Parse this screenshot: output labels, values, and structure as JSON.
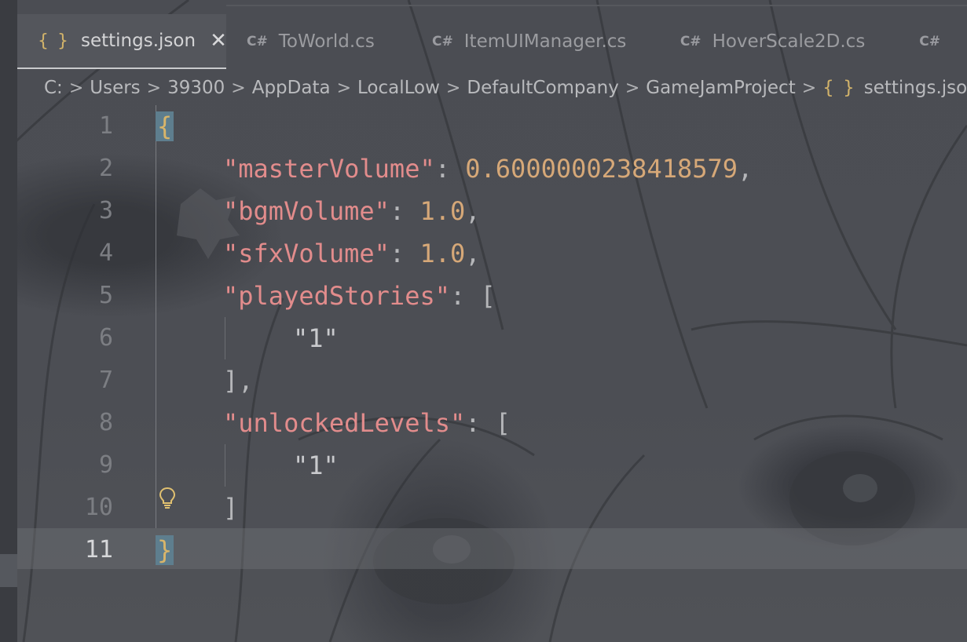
{
  "tabs": [
    {
      "icon": "{ }",
      "label": "settings.json",
      "active": true,
      "close": "✕"
    },
    {
      "icon": "C#",
      "label": "ToWorld.cs",
      "active": false
    },
    {
      "icon": "C#",
      "label": "ItemUIManager.cs",
      "active": false
    },
    {
      "icon": "C#",
      "label": "HoverScale2D.cs",
      "active": false
    },
    {
      "icon": "C#",
      "label": "",
      "active": false
    }
  ],
  "breadcrumb": {
    "items": [
      "C:",
      "Users",
      "39300",
      "AppData",
      "LocalLow",
      "DefaultCompany",
      "GameJamProject"
    ],
    "file_icon": "{ }",
    "file": "settings.json",
    "separator": ">"
  },
  "editor": {
    "current_line": 11,
    "line_numbers": [
      "1",
      "2",
      "3",
      "4",
      "5",
      "6",
      "7",
      "8",
      "9",
      "10",
      "11"
    ],
    "lines": {
      "l1": {
        "brace": "{"
      },
      "l2": {
        "key": "\"masterVolume\"",
        "colon": ": ",
        "value": "0.6000000238418579",
        "comma": ","
      },
      "l3": {
        "key": "\"bgmVolume\"",
        "colon": ": ",
        "value": "1.0",
        "comma": ","
      },
      "l4": {
        "key": "\"sfxVolume\"",
        "colon": ": ",
        "value": "1.0",
        "comma": ","
      },
      "l5": {
        "key": "\"playedStories\"",
        "colon": ": ",
        "open": "["
      },
      "l6": {
        "str": "\"1\""
      },
      "l7": {
        "close": "],"
      },
      "l8": {
        "key": "\"unlockedLevels\"",
        "colon": ": ",
        "open": "["
      },
      "l9": {
        "str": "\"1\""
      },
      "l10": {
        "close": "]"
      },
      "l11": {
        "brace": "}"
      }
    }
  },
  "colors": {
    "key": "#e28c8c",
    "number": "#d6a878",
    "brace": "#d8b56a",
    "json_icon": "#d2b36a"
  },
  "icons": {
    "json_file": "braces-icon",
    "csharp_file": "csharp-icon",
    "lightbulb": "lightbulb-icon",
    "close": "close-icon"
  }
}
